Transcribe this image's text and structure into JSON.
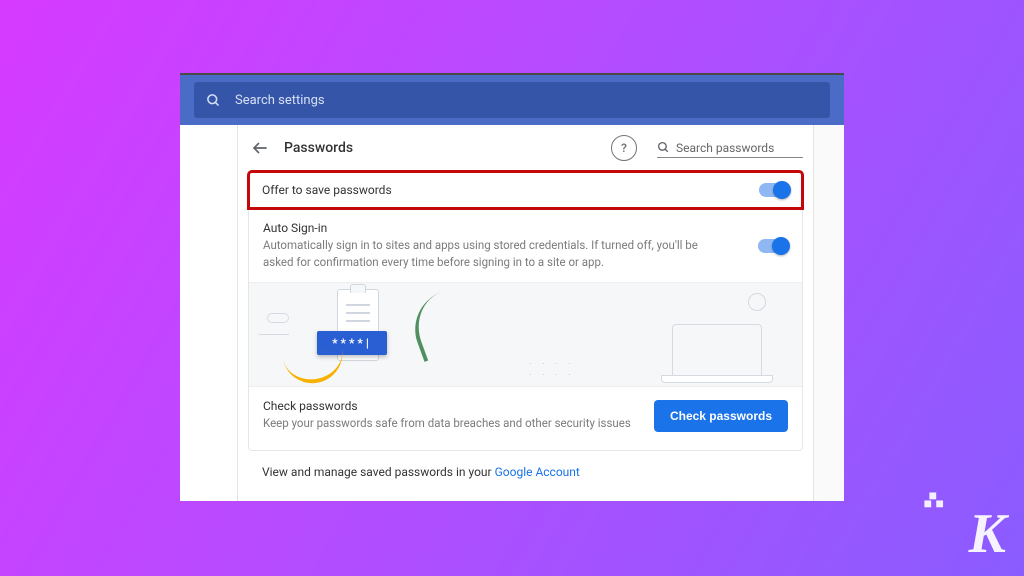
{
  "topbar": {
    "search_placeholder": "Search settings"
  },
  "page": {
    "title": "Passwords",
    "search_placeholder": "Search passwords"
  },
  "rows": {
    "offer": {
      "label": "Offer to save passwords",
      "toggle_on": true
    },
    "autosignin": {
      "label": "Auto Sign-in",
      "desc": "Automatically sign in to sites and apps using stored credentials. If turned off, you'll be asked for confirmation every time before signing in to a site or app.",
      "toggle_on": true
    }
  },
  "check": {
    "title": "Check passwords",
    "desc": "Keep your passwords safe from data breaches and other security issues",
    "button": "Check passwords"
  },
  "illus": {
    "chip_text": "****|"
  },
  "footer": {
    "prefix": "View and manage saved passwords in your ",
    "link": "Google Account"
  }
}
